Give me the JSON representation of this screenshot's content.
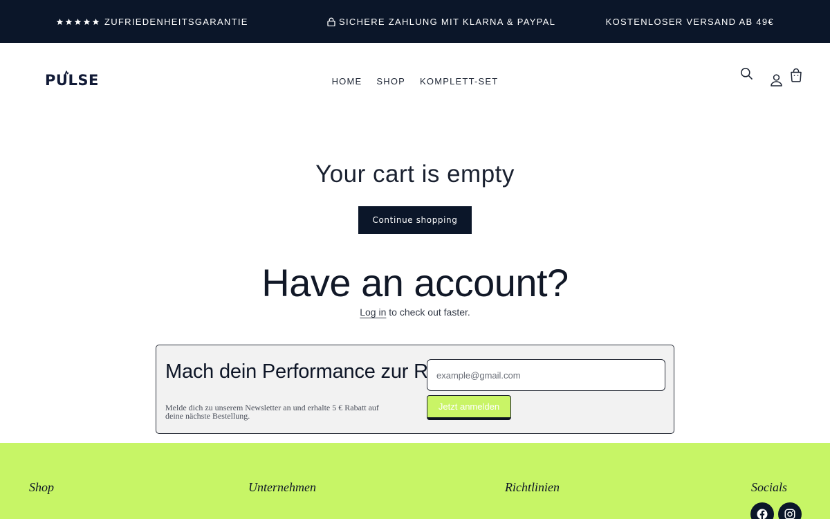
{
  "announcement": {
    "left": "Zufriedenheitsgarantie",
    "middle": "Sichere Zahlung mit Klarna & PayPal",
    "right": "Kostenloser Versand ab 49€"
  },
  "header": {
    "logo": "PULSE",
    "nav": [
      "HOME",
      "SHOP",
      "KOMPLETT-SET"
    ]
  },
  "cart": {
    "title": "Your cart is empty",
    "continue_label": "Continue shopping",
    "account_title": "Have an account?",
    "login_link": "Log in",
    "login_suffix": " to check out faster."
  },
  "newsletter": {
    "title": "Mach dein Performance zur Routine.",
    "text": "Melde dich zu unserem Newsletter an und erhalte 5 € Rabatt auf deine nächste Bestellung.",
    "placeholder": "example@gmail.com",
    "button": "Jetzt anmelden"
  },
  "footer": {
    "headings": [
      "Shop",
      "Unternehmen",
      "Richtlinien",
      "Socials"
    ]
  },
  "colors": {
    "navy": "#0b1629",
    "lime": "#c7f566"
  },
  "icons": [
    "star-icon",
    "lock-icon",
    "search-icon",
    "account-icon",
    "cart-icon",
    "facebook-icon",
    "instagram-icon"
  ]
}
